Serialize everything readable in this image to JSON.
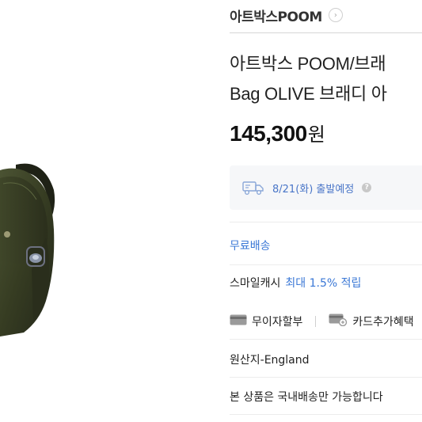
{
  "store": {
    "name": "아트박스POOM",
    "arrow": "›"
  },
  "product": {
    "title_line1": "아트박스 POOM/브래",
    "title_line2": "Bag OLIVE 브래디 아",
    "price": "145,300",
    "currency": "원"
  },
  "shipping": {
    "date_text": "8/21(화) 출발예정",
    "help_symbol": "?"
  },
  "benefits": {
    "free_shipping": "무료배송",
    "smile_cash_prefix": "스마일캐시",
    "smile_cash_highlight": "최대 1.5% 적립",
    "installment_label": "무이자할부",
    "card_benefit_label": "카드추가혜택"
  },
  "details": {
    "origin": "원산지-England",
    "domestic_only": "본 상품은 국내배송만 가능합니다"
  },
  "colors": {
    "accent_blue": "#3b78d6",
    "bag_olive": "#3a4128"
  },
  "icons": {
    "truck": "truck-icon",
    "card": "card-icon",
    "card_benefit": "card-benefit-icon",
    "help": "help-icon",
    "arrow": "chevron-right-icon"
  }
}
